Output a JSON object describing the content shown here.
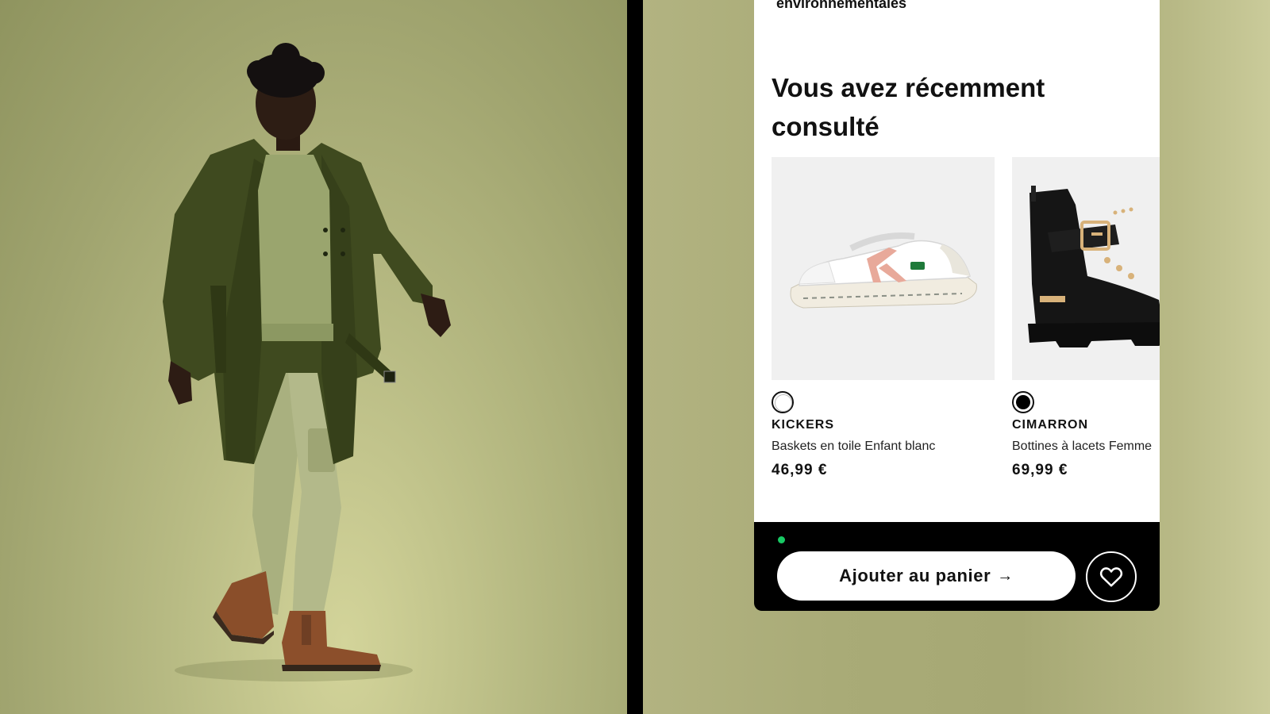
{
  "panel": {
    "env_label": "environnementales",
    "section_title": "Vous avez récemment consulté"
  },
  "products": [
    {
      "brand": "KICKERS",
      "name": "Baskets en toile Enfant blanc",
      "price": "46,99 €",
      "swatch": "white",
      "image": "white-kickers-sneaker"
    },
    {
      "brand": "CIMARRON",
      "name": "Bottines à lacets Femme",
      "price": "69,99 €",
      "swatch": "black",
      "image": "black-buckle-ankle-boot"
    }
  ],
  "cart": {
    "add_label": "Ajouter au panier",
    "arrow": "→",
    "wishlist_icon": "heart-icon",
    "status_color": "#18c964"
  },
  "colors": {
    "background_olive": "#a7aa77",
    "panel": "#ffffff",
    "bar": "#000000"
  }
}
